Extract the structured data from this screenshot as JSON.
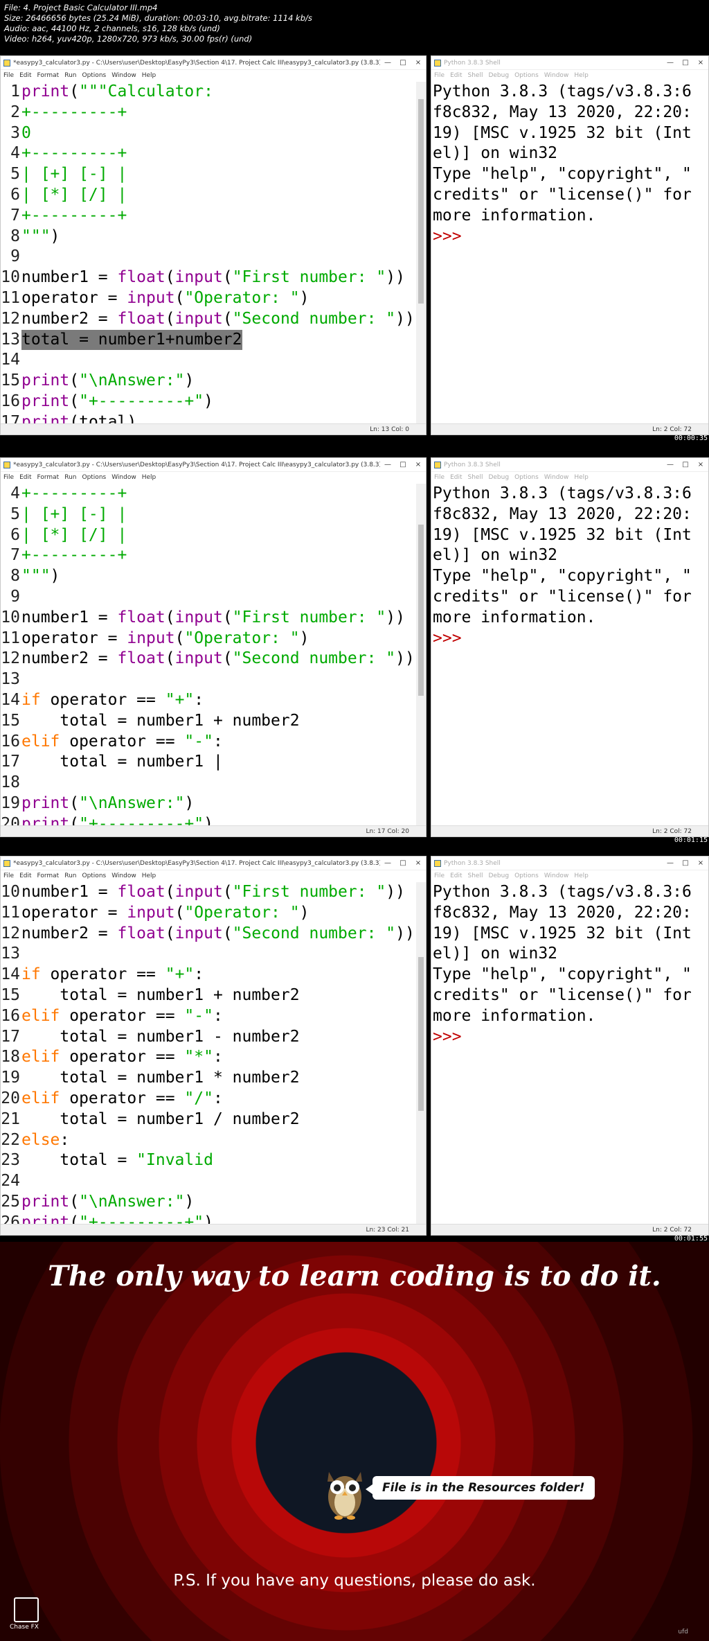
{
  "meta": [
    "File: 4. Project Basic Calculator III.mp4",
    "Size: 26466656 bytes (25.24 MiB), duration: 00:03:10, avg.bitrate: 1114 kb/s",
    "Audio: aac, 44100 Hz, 2 channels, s16, 128 kb/s (und)",
    "Video: h264, yuv420p, 1280x720, 973 kb/s, 30.00 fps(r) (und)"
  ],
  "editor_title": "*easypy3_calculator3.py - C:\\Users\\user\\Desktop\\EasyPy3\\Section 4\\17. Project Calc III\\easypy3_calculator3.py (3.8.3)*",
  "shell_title": "Python 3.8.3 Shell",
  "editor_menu": [
    "File",
    "Edit",
    "Format",
    "Run",
    "Options",
    "Window",
    "Help"
  ],
  "shell_menu": [
    "File",
    "Edit",
    "Shell",
    "Debug",
    "Options",
    "Window",
    "Help"
  ],
  "window_controls": [
    "—",
    "□",
    "×"
  ],
  "shell_lines": [
    "Python 3.8.3 (tags/v3.8.3:6",
    "f8c832, May 13 2020, 22:20:",
    "19) [MSC v.1925 32 bit (Int",
    "el)] on win32",
    "Type \"help\", \"copyright\", \"",
    "credits\" or \"license()\" for",
    "more information."
  ],
  "shell_prompt": ">>>",
  "shell_status": "Ln: 2  Col: 72",
  "frames": [
    {
      "timestamp": "00:00:35",
      "status": "Ln: 13  Col: 0",
      "thumb": {
        "top": 0.05,
        "height": 0.6
      },
      "lines": [
        {
          "n": "1",
          "t": [
            [
              "bi",
              "print"
            ],
            [
              "txt",
              "("
            ],
            [
              "str",
              "\"\"\"Calculator:"
            ]
          ]
        },
        {
          "n": "2",
          "t": [
            [
              "str",
              "+---------+"
            ]
          ]
        },
        {
          "n": "3",
          "t": [
            [
              "str",
              "0"
            ]
          ]
        },
        {
          "n": "4",
          "t": [
            [
              "str",
              "+---------+"
            ]
          ]
        },
        {
          "n": "5",
          "t": [
            [
              "str",
              "| [+] [-] |"
            ]
          ]
        },
        {
          "n": "6",
          "t": [
            [
              "str",
              "| [*] [/] |"
            ]
          ]
        },
        {
          "n": "7",
          "t": [
            [
              "str",
              "+---------+"
            ]
          ]
        },
        {
          "n": "8",
          "t": [
            [
              "str",
              "\"\"\""
            ],
            [
              "txt",
              ")"
            ]
          ]
        },
        {
          "n": "9",
          "t": []
        },
        {
          "n": "10",
          "t": [
            [
              "txt",
              "number1 = "
            ],
            [
              "bi",
              "float"
            ],
            [
              "txt",
              "("
            ],
            [
              "bi",
              "input"
            ],
            [
              "txt",
              "("
            ],
            [
              "str",
              "\"First number: \""
            ],
            [
              "txt",
              "))"
            ]
          ]
        },
        {
          "n": "11",
          "t": [
            [
              "txt",
              "operator = "
            ],
            [
              "bi",
              "input"
            ],
            [
              "txt",
              "("
            ],
            [
              "str",
              "\"Operator: \""
            ],
            [
              "txt",
              ")"
            ]
          ]
        },
        {
          "n": "12",
          "t": [
            [
              "txt",
              "number2 = "
            ],
            [
              "bi",
              "float"
            ],
            [
              "txt",
              "("
            ],
            [
              "bi",
              "input"
            ],
            [
              "txt",
              "("
            ],
            [
              "str",
              "\"Second number: \""
            ],
            [
              "txt",
              "))"
            ]
          ]
        },
        {
          "n": "13",
          "t": [
            [
              "hl",
              "total = number1+number2"
            ]
          ]
        },
        {
          "n": "14",
          "t": []
        },
        {
          "n": "15",
          "t": [
            [
              "bi",
              "print"
            ],
            [
              "txt",
              "("
            ],
            [
              "str",
              "\"\\nAnswer:\""
            ],
            [
              "txt",
              ")"
            ]
          ]
        },
        {
          "n": "16",
          "t": [
            [
              "bi",
              "print"
            ],
            [
              "txt",
              "("
            ],
            [
              "str",
              "\"+---------+\""
            ],
            [
              "txt",
              ")"
            ]
          ]
        },
        {
          "n": "17",
          "t": [
            [
              "bi",
              "print"
            ],
            [
              "txt",
              "(total)"
            ]
          ]
        }
      ]
    },
    {
      "timestamp": "00:01:15",
      "status": "Ln: 17  Col: 20",
      "thumb": {
        "top": 0.12,
        "height": 0.5
      },
      "lines": [
        {
          "n": "4",
          "t": [
            [
              "str",
              "+---------+"
            ]
          ]
        },
        {
          "n": "5",
          "t": [
            [
              "str",
              "| [+] [-] |"
            ]
          ]
        },
        {
          "n": "6",
          "t": [
            [
              "str",
              "| [*] [/] |"
            ]
          ]
        },
        {
          "n": "7",
          "t": [
            [
              "str",
              "+---------+"
            ]
          ]
        },
        {
          "n": "8",
          "t": [
            [
              "str",
              "\"\"\""
            ],
            [
              "txt",
              ")"
            ]
          ]
        },
        {
          "n": "9",
          "t": []
        },
        {
          "n": "10",
          "t": [
            [
              "txt",
              "number1 = "
            ],
            [
              "bi",
              "float"
            ],
            [
              "txt",
              "("
            ],
            [
              "bi",
              "input"
            ],
            [
              "txt",
              "("
            ],
            [
              "str",
              "\"First number: \""
            ],
            [
              "txt",
              "))"
            ]
          ]
        },
        {
          "n": "11",
          "t": [
            [
              "txt",
              "operator = "
            ],
            [
              "bi",
              "input"
            ],
            [
              "txt",
              "("
            ],
            [
              "str",
              "\"Operator: \""
            ],
            [
              "txt",
              ")"
            ]
          ]
        },
        {
          "n": "12",
          "t": [
            [
              "txt",
              "number2 = "
            ],
            [
              "bi",
              "float"
            ],
            [
              "txt",
              "("
            ],
            [
              "bi",
              "input"
            ],
            [
              "txt",
              "("
            ],
            [
              "str",
              "\"Second number: \""
            ],
            [
              "txt",
              "))"
            ]
          ]
        },
        {
          "n": "13",
          "t": []
        },
        {
          "n": "14",
          "t": [
            [
              "kw",
              "if"
            ],
            [
              "txt",
              " operator == "
            ],
            [
              "str",
              "\"+\""
            ],
            [
              "txt",
              ":"
            ]
          ]
        },
        {
          "n": "15",
          "t": [
            [
              "txt",
              "    total = number1 + number2"
            ]
          ]
        },
        {
          "n": "16",
          "t": [
            [
              "kw",
              "elif"
            ],
            [
              "txt",
              " operator == "
            ],
            [
              "str",
              "\"-\""
            ],
            [
              "txt",
              ":"
            ]
          ]
        },
        {
          "n": "17",
          "t": [
            [
              "txt",
              "    total = number1 |"
            ]
          ]
        },
        {
          "n": "18",
          "t": []
        },
        {
          "n": "19",
          "t": [
            [
              "bi",
              "print"
            ],
            [
              "txt",
              "("
            ],
            [
              "str",
              "\"\\nAnswer:\""
            ],
            [
              "txt",
              ")"
            ]
          ]
        },
        {
          "n": "20",
          "t": [
            [
              "bi",
              "print"
            ],
            [
              "txt",
              "("
            ],
            [
              "str",
              "\"+---------+\""
            ],
            [
              "txt",
              ")"
            ]
          ]
        }
      ]
    },
    {
      "timestamp": "00:01:55",
      "status": "Ln: 23  Col: 21",
      "thumb": {
        "top": 0.22,
        "height": 0.45
      },
      "lines": [
        {
          "n": "10",
          "t": [
            [
              "txt",
              "number1 = "
            ],
            [
              "bi",
              "float"
            ],
            [
              "txt",
              "("
            ],
            [
              "bi",
              "input"
            ],
            [
              "txt",
              "("
            ],
            [
              "str",
              "\"First number: \""
            ],
            [
              "txt",
              "))"
            ]
          ]
        },
        {
          "n": "11",
          "t": [
            [
              "txt",
              "operator = "
            ],
            [
              "bi",
              "input"
            ],
            [
              "txt",
              "("
            ],
            [
              "str",
              "\"Operator: \""
            ],
            [
              "txt",
              ")"
            ]
          ]
        },
        {
          "n": "12",
          "t": [
            [
              "txt",
              "number2 = "
            ],
            [
              "bi",
              "float"
            ],
            [
              "txt",
              "("
            ],
            [
              "bi",
              "input"
            ],
            [
              "txt",
              "("
            ],
            [
              "str",
              "\"Second number: \""
            ],
            [
              "txt",
              "))"
            ]
          ]
        },
        {
          "n": "13",
          "t": []
        },
        {
          "n": "14",
          "t": [
            [
              "kw",
              "if"
            ],
            [
              "txt",
              " operator == "
            ],
            [
              "str",
              "\"+\""
            ],
            [
              "txt",
              ":"
            ]
          ]
        },
        {
          "n": "15",
          "t": [
            [
              "txt",
              "    total = number1 + number2"
            ]
          ]
        },
        {
          "n": "16",
          "t": [
            [
              "kw",
              "elif"
            ],
            [
              "txt",
              " operator == "
            ],
            [
              "str",
              "\"-\""
            ],
            [
              "txt",
              ":"
            ]
          ]
        },
        {
          "n": "17",
          "t": [
            [
              "txt",
              "    total = number1 - number2"
            ]
          ]
        },
        {
          "n": "18",
          "t": [
            [
              "kw",
              "elif"
            ],
            [
              "txt",
              " operator == "
            ],
            [
              "str",
              "\"*\""
            ],
            [
              "txt",
              ":"
            ]
          ]
        },
        {
          "n": "19",
          "t": [
            [
              "txt",
              "    total = number1 * number2"
            ]
          ]
        },
        {
          "n": "20",
          "t": [
            [
              "kw",
              "elif"
            ],
            [
              "txt",
              " operator == "
            ],
            [
              "str",
              "\"/\""
            ],
            [
              "txt",
              ":"
            ]
          ]
        },
        {
          "n": "21",
          "t": [
            [
              "txt",
              "    total = number1 / number2"
            ]
          ]
        },
        {
          "n": "22",
          "t": [
            [
              "kw",
              "else"
            ],
            [
              "txt",
              ":"
            ]
          ]
        },
        {
          "n": "23",
          "t": [
            [
              "txt",
              "    total = "
            ],
            [
              "str",
              "\"Invalid"
            ]
          ]
        },
        {
          "n": "24",
          "t": []
        },
        {
          "n": "25",
          "t": [
            [
              "bi",
              "print"
            ],
            [
              "txt",
              "("
            ],
            [
              "str",
              "\"\\nAnswer:\""
            ],
            [
              "txt",
              ")"
            ]
          ]
        },
        {
          "n": "26",
          "t": [
            [
              "bi",
              "print"
            ],
            [
              "txt",
              "("
            ],
            [
              "str",
              "\"+---------+\""
            ],
            [
              "txt",
              ")"
            ]
          ]
        }
      ]
    }
  ],
  "promo": {
    "quote": "The only way to learn coding is to do it.",
    "bubble": "File is in the Resources folder!",
    "ps": "P.S. If you have any questions, please do ask.",
    "logo_text": "Chase FX",
    "watermark": "ufd"
  },
  "colors": {
    "keyword": "#ff7700",
    "builtin": "#900090",
    "string": "#00aa00",
    "prompt": "#c00000",
    "highlight": "#7a7a7a"
  }
}
